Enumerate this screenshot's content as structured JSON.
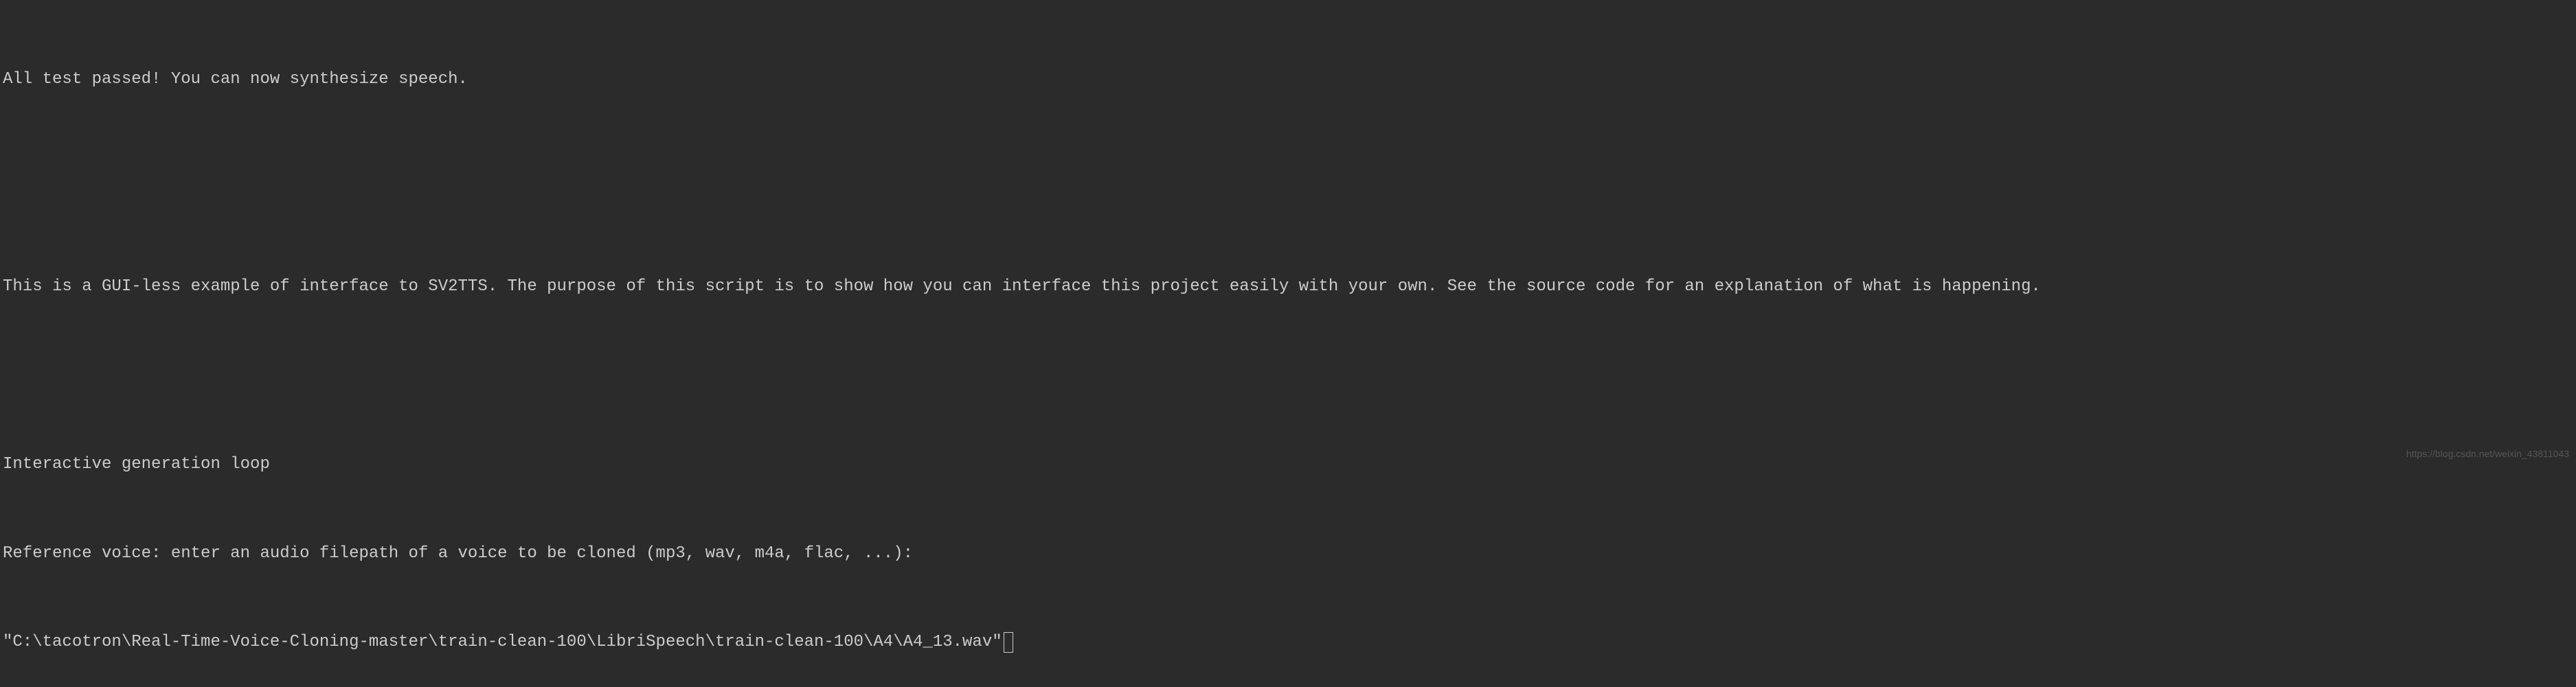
{
  "terminal": {
    "line1": "All test passed! You can now synthesize speech.",
    "line2": "This is a GUI-less example of interface to SV2TTS. The purpose of this script is to show how you can interface this project easily with your own. See the source code for an explanation of what is happening.",
    "line3": "Interactive generation loop",
    "line4": "Reference voice: enter an audio filepath of a voice to be cloned (mp3, wav, m4a, flac, ...):",
    "input_value": "\"C:\\tacotron\\Real-Time-Voice-Cloning-master\\train-clean-100\\LibriSpeech\\train-clean-100\\A4\\A4_13.wav\""
  },
  "watermark": "https://blog.csdn.net/weixin_43811043"
}
